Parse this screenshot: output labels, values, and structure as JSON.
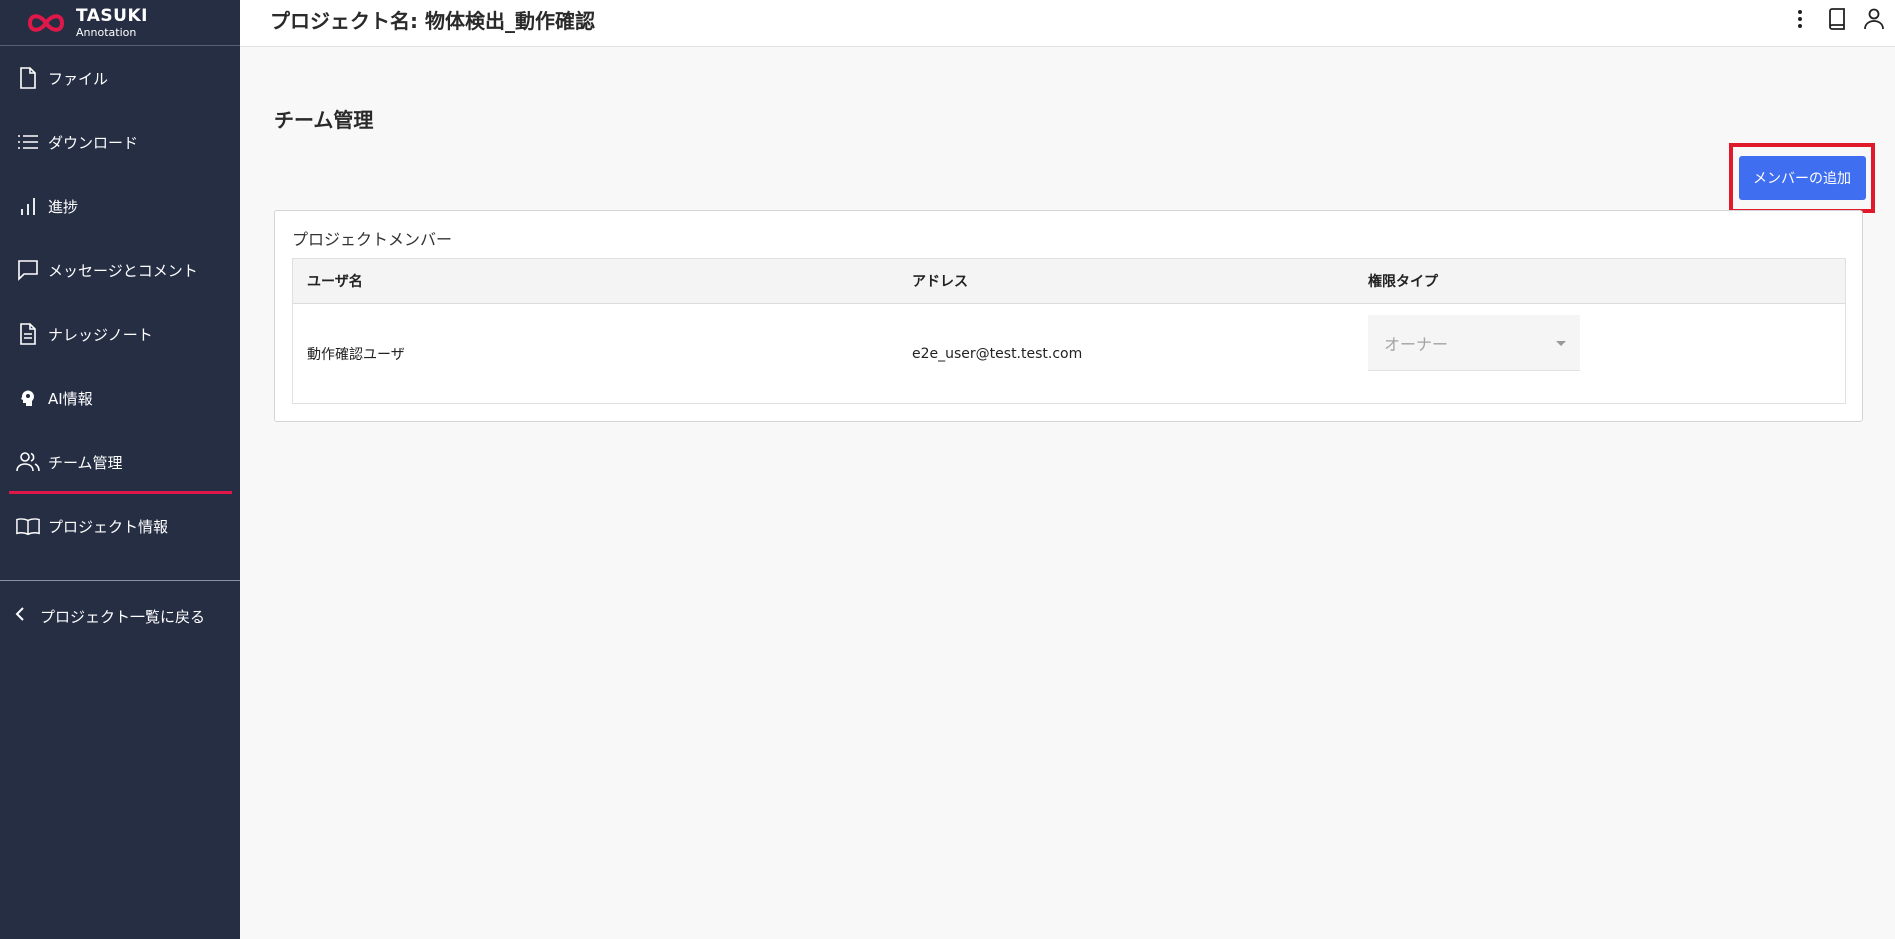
{
  "brand": {
    "title": "TASUKI",
    "subtitle": "Annotation",
    "accent": "#e0184a"
  },
  "header": {
    "project_title": "プロジェクト名: 物体検出_動作確認"
  },
  "sidebar": {
    "items": [
      {
        "label": "ファイル",
        "icon": "file-icon"
      },
      {
        "label": "ダウンロード",
        "icon": "list-icon"
      },
      {
        "label": "進捗",
        "icon": "bar-chart-icon"
      },
      {
        "label": "メッセージとコメント",
        "icon": "message-icon"
      },
      {
        "label": "ナレッジノート",
        "icon": "document-icon"
      },
      {
        "label": "AI情報",
        "icon": "brain-icon"
      },
      {
        "label": "チーム管理",
        "icon": "users-icon",
        "active": true
      },
      {
        "label": "プロジェクト情報",
        "icon": "book-icon"
      }
    ],
    "back_label": "プロジェクト一覧に戻る"
  },
  "main": {
    "page_title": "チーム管理",
    "add_button": "メンバーの追加",
    "card_title": "プロジェクトメンバー",
    "table": {
      "headers": [
        "ユーザ名",
        "アドレス",
        "権限タイプ"
      ],
      "rows": [
        {
          "username": "動作確認ユーザ",
          "address": "e2e_user@test.test.com",
          "role": "オーナー"
        }
      ]
    }
  },
  "colors": {
    "sidebar_bg": "#262e44",
    "primary_button": "#3f6ef0",
    "highlight_box": "#e01a2b"
  }
}
